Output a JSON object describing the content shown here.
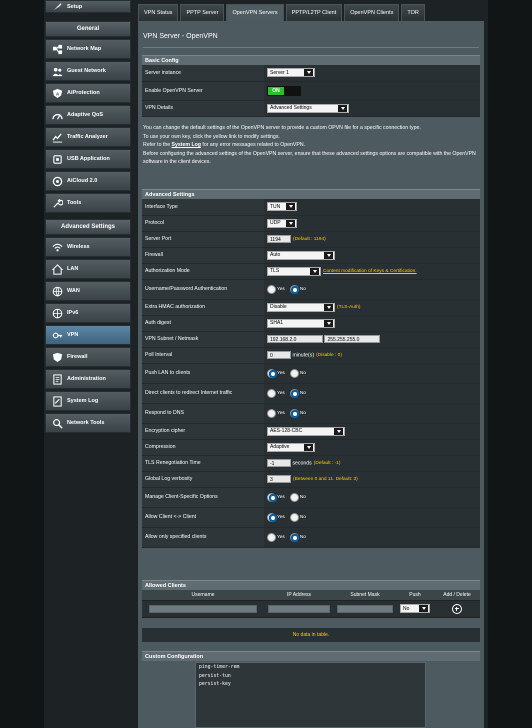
{
  "sidebar": {
    "setup_label": "Setup",
    "general_header": "General",
    "general_items": [
      {
        "label": "Network Map",
        "icon": "network-map-icon"
      },
      {
        "label": "Guest Network",
        "icon": "guest-network-icon"
      },
      {
        "label": "AiProtection",
        "icon": "aiprotection-icon"
      },
      {
        "label": "Adaptive QoS",
        "icon": "qos-icon"
      },
      {
        "label": "Traffic Analyzer",
        "icon": "traffic-icon"
      },
      {
        "label": "USB Application",
        "icon": "usb-icon"
      },
      {
        "label": "AiCloud 2.0",
        "icon": "cloud-icon"
      },
      {
        "label": "Tools",
        "icon": "tools-icon"
      }
    ],
    "advanced_header": "Advanced Settings",
    "advanced_items": [
      {
        "label": "Wireless",
        "icon": "wireless-icon"
      },
      {
        "label": "LAN",
        "icon": "lan-icon"
      },
      {
        "label": "WAN",
        "icon": "wan-icon"
      },
      {
        "label": "IPv6",
        "icon": "ipv6-icon"
      },
      {
        "label": "VPN",
        "icon": "vpn-icon"
      },
      {
        "label": "Firewall",
        "icon": "firewall-icon"
      },
      {
        "label": "Administration",
        "icon": "administration-icon"
      },
      {
        "label": "System Log",
        "icon": "system-log-icon"
      },
      {
        "label": "Network Tools",
        "icon": "network-tools-icon"
      }
    ]
  },
  "tabs": [
    "VPN Status",
    "PPTP Server",
    "OpenVPN Servers",
    "PPTP/L2TP Client",
    "OpenVPN Clients",
    "TOR"
  ],
  "page_title": "VPN Server - OpenVPN",
  "basic": {
    "header": "Basic Config",
    "server_instance_label": "Server instance",
    "server_instance_value": "Server 1",
    "enable_label": "Enable OpenVPN Server",
    "enable_on": "ON",
    "details_label": "VPN Details",
    "details_value": "Advanced Settings"
  },
  "description": {
    "line1": "You can change the default settings of the OpenVPN server to provide a custom OPVN file for a specific connection type.",
    "line2": "To use your own key, click the yellow link to modify settings.",
    "line3_pre": "Refer to the ",
    "line3_link": "System Log",
    "line3_post": " for any error messages related to OpenVPN.",
    "line4": "Before configuring the advanced settings of the OpenVPN server, ensure that these advanced settings options are compatible with the OpenVPN software in the client devices."
  },
  "advanced": {
    "header": "Advanced Settings",
    "interface_type_label": "Interface Type",
    "interface_type_value": "TUN",
    "protocol_label": "Protocol",
    "protocol_value": "UDP",
    "port_label": "Server Port",
    "port_value": "1194",
    "port_hint": "(Default : 1194)",
    "firewall_label": "Firewall",
    "firewall_value": "Auto",
    "auth_mode_label": "Authorization Mode",
    "auth_mode_value": "TLS",
    "auth_mode_link": "Content modification of Keys & Certification.",
    "userpass_label": "Username/Password Authentication",
    "hmac_label": "Extra HMAC authorization",
    "hmac_value": "Disable",
    "hmac_hint": "(TLS-Auth)",
    "digest_label": "Auth digest",
    "digest_value": "SHA1",
    "subnet_label": "VPN Subnet / Netmask",
    "subnet_value": "192.168.2.0",
    "netmask_value": "255.255.255.0",
    "poll_label": "Poll Interval",
    "poll_value": "0",
    "poll_unit": "minute(s)",
    "poll_hint": "(Disable : 0)",
    "push_lan_label": "Push LAN to clients",
    "redirect_label": "Direct clients to redirect Internet traffic",
    "dns_label": "Respond to DNS",
    "cipher_label": "Encryption cipher",
    "cipher_value": "AES-128-CBC",
    "compression_label": "Compression",
    "compression_value": "Adaptive",
    "reneg_label": "TLS Renegotiation Time",
    "reneg_value": "-1",
    "reneg_unit": "seconds",
    "reneg_hint": "(Default : -1)",
    "verbosity_label": "Global Log verbosity",
    "verbosity_value": "3",
    "verbosity_hint": "(Between 0 and 11. Default: 3)",
    "client_specific_label": "Manage Client-Specific Options",
    "c2c_label": "Allow Client <-> Client",
    "specified_label": "Allow only specified clients",
    "yes": "Yes",
    "no": "No"
  },
  "allowed_clients": {
    "header": "Allowed Clients",
    "columns": [
      "Username",
      "IP Address",
      "Subnet Mask",
      "Push",
      "Add / Delete"
    ],
    "push_value": "No",
    "empty_text": "No data in table."
  },
  "custom": {
    "header": "Custom Configuration",
    "lines": [
      "ping-timer-rem",
      "persist-tun",
      "persist-key"
    ]
  }
}
